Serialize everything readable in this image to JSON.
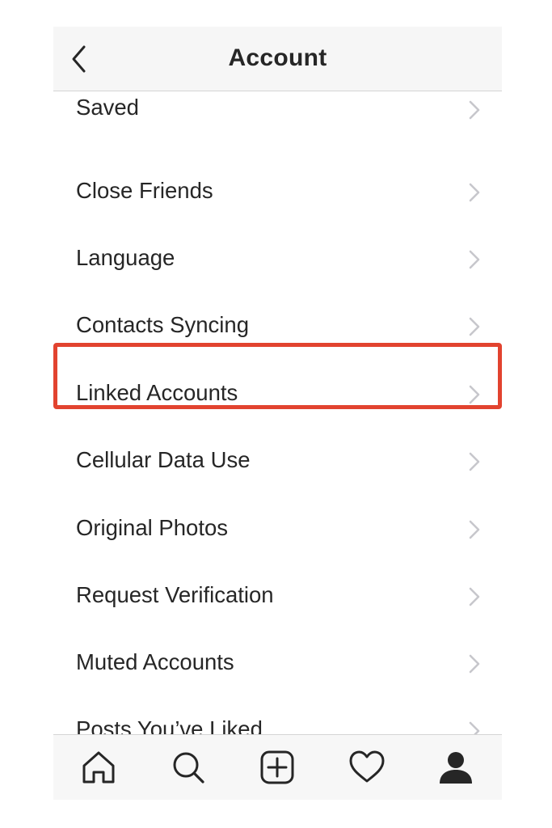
{
  "header": {
    "title": "Account",
    "back_icon": "chevron-left-icon"
  },
  "menu": {
    "items": [
      {
        "label": "Saved"
      },
      {
        "label": "Close Friends"
      },
      {
        "label": "Language"
      },
      {
        "label": "Contacts Syncing"
      },
      {
        "label": "Linked Accounts",
        "highlighted": true
      },
      {
        "label": "Cellular Data Use"
      },
      {
        "label": "Original Photos"
      },
      {
        "label": "Request Verification"
      },
      {
        "label": "Muted Accounts"
      },
      {
        "label": "Posts You’ve Liked"
      }
    ],
    "chevron_icon": "chevron-right-icon"
  },
  "tabbar": {
    "tabs": [
      {
        "icon": "home-icon"
      },
      {
        "icon": "search-icon"
      },
      {
        "icon": "add-post-icon"
      },
      {
        "icon": "heart-icon"
      },
      {
        "icon": "profile-icon",
        "active": true
      }
    ]
  },
  "colors": {
    "highlight": "#e2432f",
    "text": "#262626",
    "chevron": "#c7c7cc",
    "bar_background": "#f6f6f6"
  }
}
